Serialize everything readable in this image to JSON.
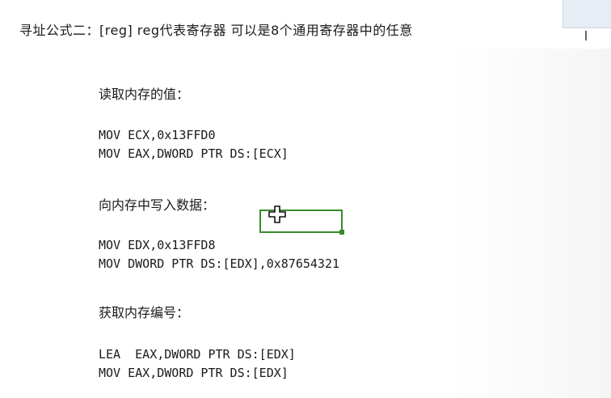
{
  "document": {
    "heading": "寻址公式二：[reg]  reg代表寄存器 可以是8个通用寄存器中的任意"
  },
  "sections": [
    {
      "label": "读取内存的值：",
      "lines": [
        "MOV ECX,0x13FFD0",
        "MOV EAX,DWORD PTR DS:[ECX]"
      ]
    },
    {
      "label": "向内存中写入数据：",
      "lines": [
        "MOV EDX,0x13FFD8",
        "MOV DWORD PTR DS:[EDX],0x87654321"
      ]
    },
    {
      "label": "获取内存编号：",
      "lines": [
        "LEA  EAX,DWORD PTR DS:[EDX]",
        "MOV EAX,DWORD PTR DS:[EDX]"
      ]
    }
  ],
  "selection": {
    "color": "#3b8a2e"
  }
}
